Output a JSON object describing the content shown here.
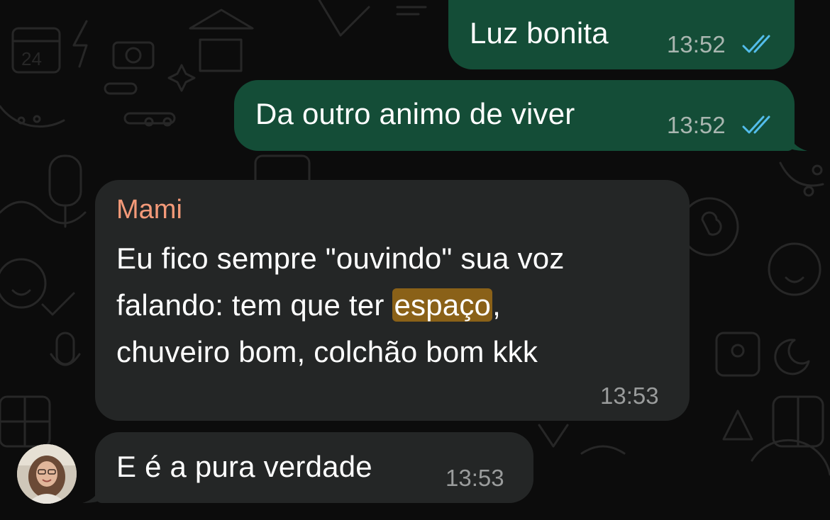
{
  "messages": [
    {
      "direction": "outgoing",
      "text": "Luz bonita",
      "time": "13:52",
      "status": "read-double-check"
    },
    {
      "direction": "outgoing",
      "text": "Da outro animo de viver",
      "time": "13:52",
      "status": "read-double-check"
    },
    {
      "direction": "incoming",
      "sender": "Mami",
      "text_before_highlight": "Eu fico sempre \"ouvindo\" sua voz\nfalando: tem que ter ",
      "highlight": "espaço",
      "text_after_highlight": ",\nchuveiro bom, colchão bom kkk",
      "time": "13:53"
    },
    {
      "direction": "incoming",
      "text": "E é a pura verdade",
      "time": "13:53"
    }
  ],
  "colors": {
    "outgoing_bubble": "#144d37",
    "incoming_bubble": "#242626",
    "sender_name": "#f49a79",
    "read_ticks": "#53bdeb",
    "highlight": "#8a6118"
  },
  "icons": {
    "read_status": "double-check-icon",
    "avatar": "contact-avatar"
  }
}
